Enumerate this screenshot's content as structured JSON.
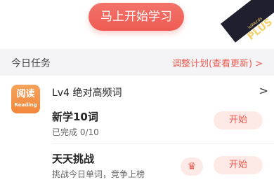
{
  "top": {
    "start_button": "马上开始学习",
    "badge_small": "loWords",
    "badge_plus": "PLUS"
  },
  "section": {
    "title": "今日任务",
    "adjust_link": "调整计划(查看更新)",
    "adjust_arrow": ">"
  },
  "book": {
    "icon_text_big": "阅读",
    "icon_text_small": "Reading",
    "title": "Lv4 绝对高频词",
    "arrow": ">"
  },
  "tasks": [
    {
      "title": "新学10词",
      "subtitle": "已完成 0/10",
      "button": "开始"
    },
    {
      "title": "天天挑战",
      "subtitle": "挑战今日单词，竞争上榜",
      "crown_icon": "♛",
      "button": "开始"
    }
  ],
  "colors": {
    "accent": "#ee5b52",
    "pill_bg": "#fde9e6",
    "section_bg": "#f4f4f6",
    "book_icon": "#f2873b"
  }
}
